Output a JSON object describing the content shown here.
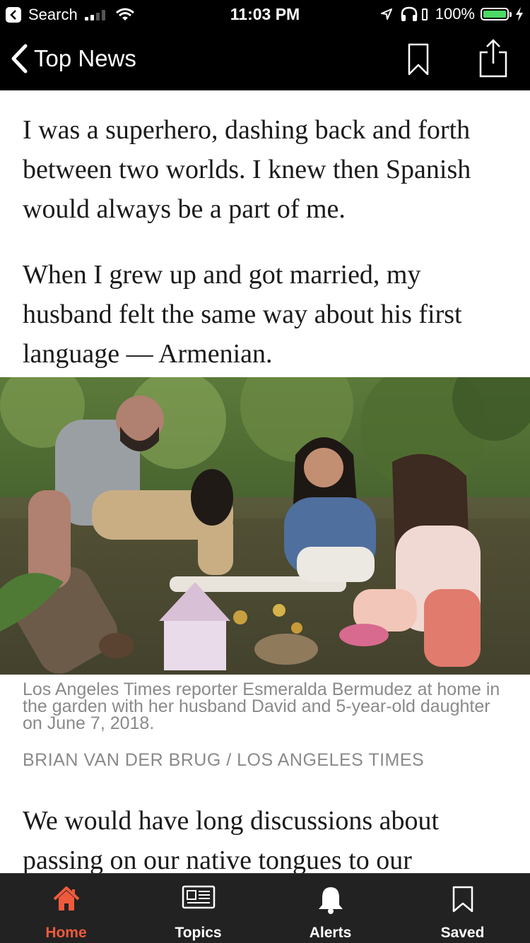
{
  "status_bar": {
    "back_app": "Search",
    "time": "11:03 PM",
    "battery": "100%",
    "battery_level": 1.0
  },
  "nav": {
    "back_label": "Top News",
    "icons": [
      "chevron-left-icon",
      "bookmark-icon",
      "share-icon"
    ]
  },
  "article": {
    "paragraph_1": "I was a superhero, dashing back and forth between two worlds. I knew then Spanish would always be a part of me.",
    "paragraph_2": "When I grew up and got married, my husband felt the same way about his first language — Armenian.",
    "photo_caption": "Los Angeles Times reporter Esmeralda Bermudez at home in the garden with her husband David and 5-year-old daughter on June 7, 2018.",
    "photo_credit": "BRIAN VAN DER BRUG / LOS ANGELES TIMES",
    "paragraph_3": "We would have long discussions about passing on our native tongues to our"
  },
  "tab_bar": {
    "active": "Home",
    "accent_color": "#ef5a3c",
    "tabs": [
      {
        "label": "Home",
        "icon": "home-icon"
      },
      {
        "label": "Topics",
        "icon": "newspaper-icon"
      },
      {
        "label": "Alerts",
        "icon": "bell-icon"
      },
      {
        "label": "Saved",
        "icon": "bookmark-icon"
      }
    ]
  }
}
